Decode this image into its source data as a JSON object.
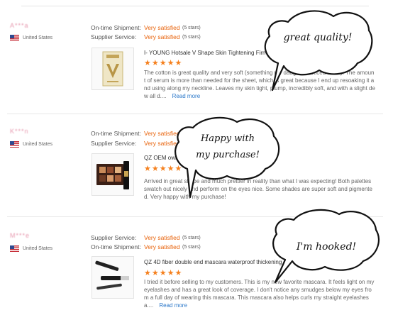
{
  "labels": {
    "shipment": "On-time Shipment:",
    "service": "Supplier Service:",
    "satisfied": "Very satisfied",
    "five_stars": "(5 stars)",
    "read_more": "Read more"
  },
  "reviews": [
    {
      "buyer": "A***a",
      "country": "United States",
      "product_title": "I- YOUNG Hotsale V Shape Skin Tightening Firming",
      "stars": "★★★★★",
      "text": "The cotton is great quality and very soft (something my daughter noticed black). The amount of serum is more than needed for the sheet, which is great because I end up resoaking it and using along my neckline. Leaves my skin tight, plump, incredibly soft, and with a slight dew all d....",
      "bubble": "great quality!"
    },
    {
      "buyer": "K***n",
      "country": "United States",
      "product_title": "QZ OEM own brand eyeshadow palette eyebrow",
      "stars": "★★★★★",
      "text": "Arrived in great shape and much prettier in reality than what I was expecting! Both palettes swatch out nicely and perform on the eyes nice. Some shades are super soft and pigmented. Very happy with my purchase!",
      "bubble": "Happy with my purchase!",
      "bubble_lines": [
        "Happy with",
        "my purchase!"
      ]
    },
    {
      "buyer": "M***e",
      "country": "United States",
      "product_title": "QZ 4D fiber double end mascara waterproof thickening",
      "stars": "★★★★★",
      "text": "I tried it before selling to my customers. This is my new favorite mascara. It feels light on my eyelashes and has a great look of coverage. I don't notice any smudges below my eyes from a full day of wearing this mascara. This mascara also helps curls my straight eyelashes a....",
      "bubble": "I'm hooked!"
    }
  ]
}
